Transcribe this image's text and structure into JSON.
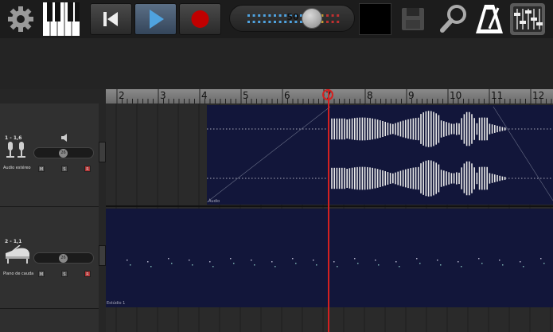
{
  "toolbar": {
    "tempo_value": "50",
    "icons": [
      "gear-icon",
      "piano-icon",
      "skip-back-icon",
      "play-icon",
      "record-icon",
      "save-icon",
      "search-icon",
      "metronome-icon",
      "mixer-icon"
    ]
  },
  "ruler": {
    "bars": [
      "2",
      "3",
      "4",
      "5",
      "6",
      "7",
      "8",
      "9",
      "10",
      "11",
      "12"
    ]
  },
  "tracks": [
    {
      "id": "1 - 1,6",
      "name": "Audio estéreo",
      "volume_value": "26",
      "mute": "M",
      "solo": "S",
      "record": "R"
    },
    {
      "id": "2 - 1,1",
      "name": "Piano de cauda",
      "volume_value": "26",
      "mute": "M",
      "solo": "S",
      "record": "R"
    }
  ],
  "clips": [
    {
      "label": "Áudio"
    },
    {
      "label": "Estúdio 1"
    }
  ],
  "colors": {
    "accent": "#4fa3e0",
    "record": "#c00000",
    "playhead": "#d42020",
    "clip": "#12163a"
  }
}
